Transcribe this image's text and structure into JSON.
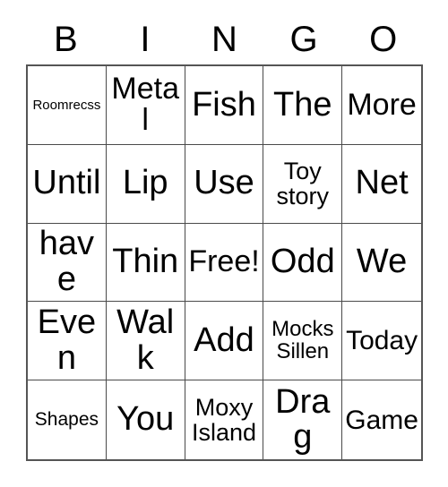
{
  "card": {
    "headers": [
      "B",
      "I",
      "N",
      "G",
      "O"
    ],
    "rows": [
      [
        {
          "text": "Roomrecss",
          "size": "tiny"
        },
        {
          "text": "Metal",
          "size": "lg"
        },
        {
          "text": "Fish",
          "size": "xl"
        },
        {
          "text": "The",
          "size": "xl"
        },
        {
          "text": "More",
          "size": "lg"
        }
      ],
      [
        {
          "text": "Until",
          "size": "xl"
        },
        {
          "text": "Lip",
          "size": "xl"
        },
        {
          "text": "Use",
          "size": "xl"
        },
        {
          "text": "Toy story",
          "size": "sm"
        },
        {
          "text": "Net",
          "size": "xl"
        }
      ],
      [
        {
          "text": "have",
          "size": "xl"
        },
        {
          "text": "Thin",
          "size": "xl"
        },
        {
          "text": "Free!",
          "size": "lg"
        },
        {
          "text": "Odd",
          "size": "xl"
        },
        {
          "text": "We",
          "size": "xl"
        }
      ],
      [
        {
          "text": "Even",
          "size": "xl"
        },
        {
          "text": "Walk",
          "size": "xl"
        },
        {
          "text": "Add",
          "size": "xl"
        },
        {
          "text": "Mocks Sillen",
          "size": "xs"
        },
        {
          "text": "Today",
          "size": "md"
        }
      ],
      [
        {
          "text": "Shapes",
          "size": "xxs"
        },
        {
          "text": "You",
          "size": "xl"
        },
        {
          "text": "Moxy Island",
          "size": "sm"
        },
        {
          "text": "Drag",
          "size": "xl"
        },
        {
          "text": "Game",
          "size": "md"
        }
      ]
    ],
    "colors": {
      "background": "#ffffff",
      "text": "#000000",
      "grid_line": "#4a4a4a",
      "outer_border": "#555555"
    }
  }
}
